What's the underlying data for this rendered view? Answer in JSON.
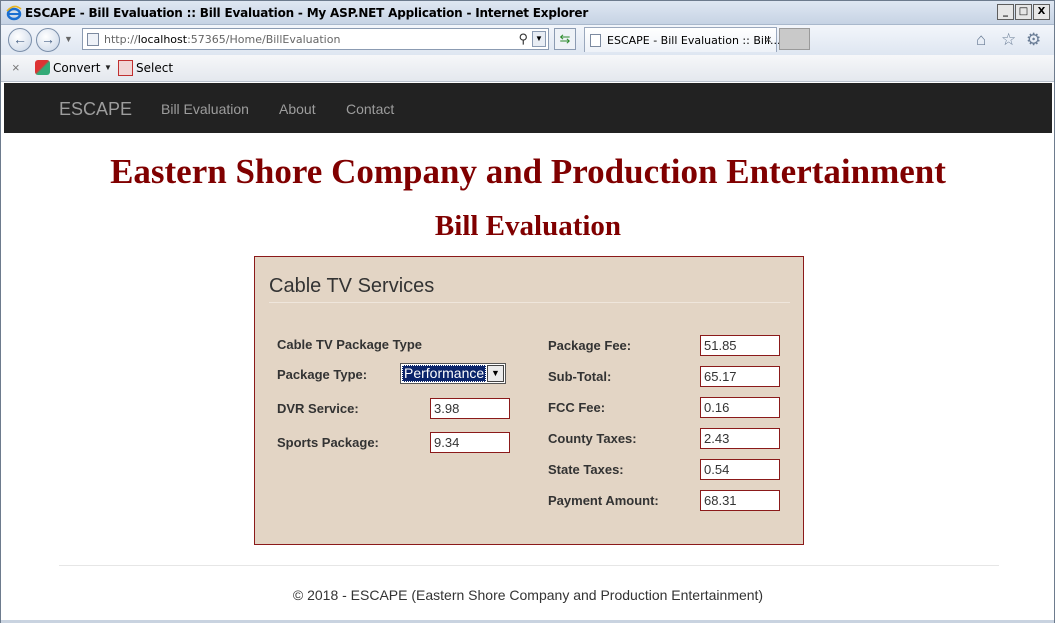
{
  "window": {
    "title": "ESCAPE - Bill Evaluation :: Bill Evaluation - My ASP.NET Application - Internet Explorer",
    "minimize": "_",
    "maximize": "□",
    "close": "X"
  },
  "browser": {
    "address_prefix": "http://",
    "address_host": "localhost",
    "address_rest": ":57365/Home/BillEvaluation",
    "tab_title": "ESCAPE - Bill Evaluation :: Bill...",
    "tab_close": "×"
  },
  "command_bar": {
    "close": "×",
    "convert_label": "Convert",
    "select_label": "Select"
  },
  "site_nav": {
    "brand": "ESCAPE",
    "links": [
      "Bill Evaluation",
      "About",
      "Contact"
    ]
  },
  "page": {
    "company_title": "Eastern Shore Company and Production Entertainment",
    "title": "Bill Evaluation"
  },
  "panel": {
    "heading": "Cable TV Services",
    "left": {
      "section_label": "Cable TV Package Type",
      "package_type_label": "Package Type:",
      "package_type_value": "Performance",
      "dvr_label": "DVR Service:",
      "dvr_value": "3.98",
      "sports_label": "Sports Package:",
      "sports_value": "9.34"
    },
    "right": {
      "package_fee_label": "Package Fee:",
      "package_fee_value": "51.85",
      "subtotal_label": "Sub-Total:",
      "subtotal_value": "65.17",
      "fcc_fee_label": "FCC Fee:",
      "fcc_fee_value": "0.16",
      "county_taxes_label": "County Taxes:",
      "county_taxes_value": "2.43",
      "state_taxes_label": "State Taxes:",
      "state_taxes_value": "0.54",
      "payment_label": "Payment Amount:",
      "payment_value": "68.31"
    }
  },
  "footer": {
    "text": "© 2018 - ESCAPE (Eastern Shore Company and Production Entertainment)"
  },
  "colors": {
    "title_maroon": "#800000",
    "panel_bg": "#e3d5c5",
    "panel_border": "#8b1a1a",
    "nav_bg": "#222222"
  }
}
